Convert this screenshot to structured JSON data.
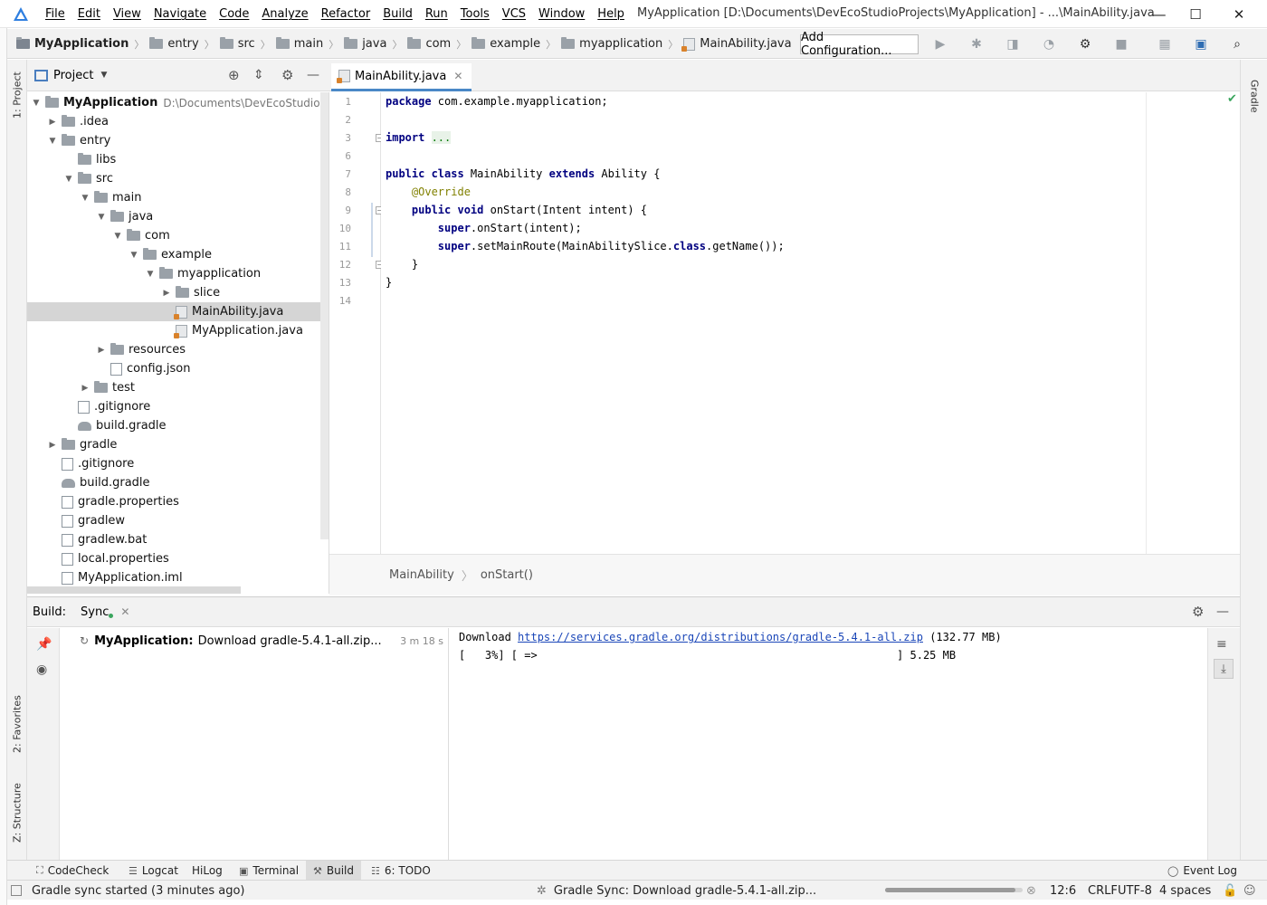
{
  "window": {
    "title": "MyApplication [D:\\Documents\\DevEcoStudioProjects\\MyApplication] - ...\\MainAbility.java",
    "menu": [
      "File",
      "Edit",
      "View",
      "Navigate",
      "Code",
      "Analyze",
      "Refactor",
      "Build",
      "Run",
      "Tools",
      "VCS",
      "Window",
      "Help"
    ],
    "minimize": "—",
    "maximize": "☐",
    "close": "✕"
  },
  "navbar": {
    "crumbs": [
      "MyApplication",
      "entry",
      "src",
      "main",
      "java",
      "com",
      "example",
      "myapplication",
      "MainAbility.java"
    ],
    "add_configuration": "Add Configuration..."
  },
  "left_strip": {
    "project": "1: Project",
    "favorites": "2: Favorites",
    "structure": "Z: Structure"
  },
  "right_strip": {
    "gradle": "Gradle"
  },
  "project_panel": {
    "header": "Project",
    "root_name": "MyApplication",
    "root_path": "D:\\Documents\\DevEcoStudioProjects\\MyApplication",
    "tree": [
      {
        "label": ".idea",
        "depth": 1,
        "icon": "folder",
        "arrow": "closed"
      },
      {
        "label": "entry",
        "depth": 1,
        "icon": "folder",
        "arrow": "open"
      },
      {
        "label": "libs",
        "depth": 2,
        "icon": "folder",
        "arrow": "none"
      },
      {
        "label": "src",
        "depth": 2,
        "icon": "folder",
        "arrow": "open"
      },
      {
        "label": "main",
        "depth": 3,
        "icon": "folder",
        "arrow": "open"
      },
      {
        "label": "java",
        "depth": 4,
        "icon": "folder",
        "arrow": "open"
      },
      {
        "label": "com",
        "depth": 5,
        "icon": "folder",
        "arrow": "open"
      },
      {
        "label": "example",
        "depth": 6,
        "icon": "folder",
        "arrow": "open"
      },
      {
        "label": "myapplication",
        "depth": 7,
        "icon": "folder",
        "arrow": "open"
      },
      {
        "label": "slice",
        "depth": 8,
        "icon": "folder",
        "arrow": "closed"
      },
      {
        "label": "MainAbility.java",
        "depth": 8,
        "icon": "java",
        "arrow": "none",
        "selected": true
      },
      {
        "label": "MyApplication.java",
        "depth": 8,
        "icon": "java",
        "arrow": "none"
      },
      {
        "label": "resources",
        "depth": 4,
        "icon": "folder",
        "arrow": "closed"
      },
      {
        "label": "config.json",
        "depth": 4,
        "icon": "file",
        "arrow": "none"
      },
      {
        "label": "test",
        "depth": 3,
        "icon": "folder",
        "arrow": "closed"
      },
      {
        "label": ".gitignore",
        "depth": 2,
        "icon": "file",
        "arrow": "none"
      },
      {
        "label": "build.gradle",
        "depth": 2,
        "icon": "gradle",
        "arrow": "none"
      },
      {
        "label": "gradle",
        "depth": 1,
        "icon": "folder",
        "arrow": "closed"
      },
      {
        "label": ".gitignore",
        "depth": 1,
        "icon": "file",
        "arrow": "none"
      },
      {
        "label": "build.gradle",
        "depth": 1,
        "icon": "gradle",
        "arrow": "none"
      },
      {
        "label": "gradle.properties",
        "depth": 1,
        "icon": "file",
        "arrow": "none"
      },
      {
        "label": "gradlew",
        "depth": 1,
        "icon": "file",
        "arrow": "none"
      },
      {
        "label": "gradlew.bat",
        "depth": 1,
        "icon": "file",
        "arrow": "none"
      },
      {
        "label": "local.properties",
        "depth": 1,
        "icon": "file",
        "arrow": "none"
      },
      {
        "label": "MyApplication.iml",
        "depth": 1,
        "icon": "file",
        "arrow": "none"
      }
    ]
  },
  "editor": {
    "tab_label": "MainAbility.java",
    "line_numbers": [
      "1",
      "2",
      "3",
      "6",
      "7",
      "8",
      "9",
      "10",
      "11",
      "12",
      "13",
      "14"
    ],
    "lines": [
      [
        {
          "t": "package ",
          "c": "kw"
        },
        {
          "t": "com.example.myapplication;",
          "c": ""
        }
      ],
      [],
      [
        {
          "t": "import ",
          "c": "kw"
        },
        {
          "t": "...",
          "c": "fold-dots"
        }
      ],
      [],
      [
        {
          "t": "public class ",
          "c": "kw"
        },
        {
          "t": "MainAbility ",
          "c": ""
        },
        {
          "t": "extends ",
          "c": "kw"
        },
        {
          "t": "Ability {",
          "c": ""
        }
      ],
      [
        {
          "t": "    @Override",
          "c": "ann"
        }
      ],
      [
        {
          "t": "    ",
          "c": ""
        },
        {
          "t": "public void ",
          "c": "kw"
        },
        {
          "t": "onStart(Intent intent) {",
          "c": ""
        }
      ],
      [
        {
          "t": "        ",
          "c": ""
        },
        {
          "t": "super",
          "c": "kw"
        },
        {
          "t": ".onStart(intent);",
          "c": ""
        }
      ],
      [
        {
          "t": "        ",
          "c": ""
        },
        {
          "t": "super",
          "c": "kw"
        },
        {
          "t": ".setMainRoute(MainAbilitySlice.",
          "c": ""
        },
        {
          "t": "class",
          "c": "kw"
        },
        {
          "t": ".getName());",
          "c": ""
        }
      ],
      [
        {
          "t": "    }",
          "c": ""
        }
      ],
      [
        {
          "t": "}",
          "c": ""
        }
      ],
      []
    ],
    "breadcrumb": [
      "MainAbility",
      "onStart()"
    ]
  },
  "build_panel": {
    "label": "Build:",
    "tab": "Sync",
    "tree_item_bold": "MyApplication:",
    "tree_item_text": "Download gradle-5.4.1-all.zip...",
    "tree_item_time": "3 m 18 s",
    "out_line1_prefix": "Download ",
    "out_line1_link": "https://services.gradle.org/distributions/gradle-5.4.1-all.zip",
    "out_line1_suffix": " (132.77 MB)",
    "out_line2": "[   3%] [ =>                                                       ] 5.25 MB"
  },
  "bottom_tools": [
    "CodeCheck",
    "Logcat",
    "HiLog",
    "Terminal",
    "Build",
    "6: TODO",
    "Event Log"
  ],
  "status": {
    "left": "Gradle sync started (3 minutes ago)",
    "task": "Gradle Sync: Download gradle-5.4.1-all.zip...",
    "progress_fraction": 0.95,
    "position": "12:6",
    "line_sep": "CRLF",
    "encoding": "UTF-8",
    "indent": "4 spaces"
  }
}
